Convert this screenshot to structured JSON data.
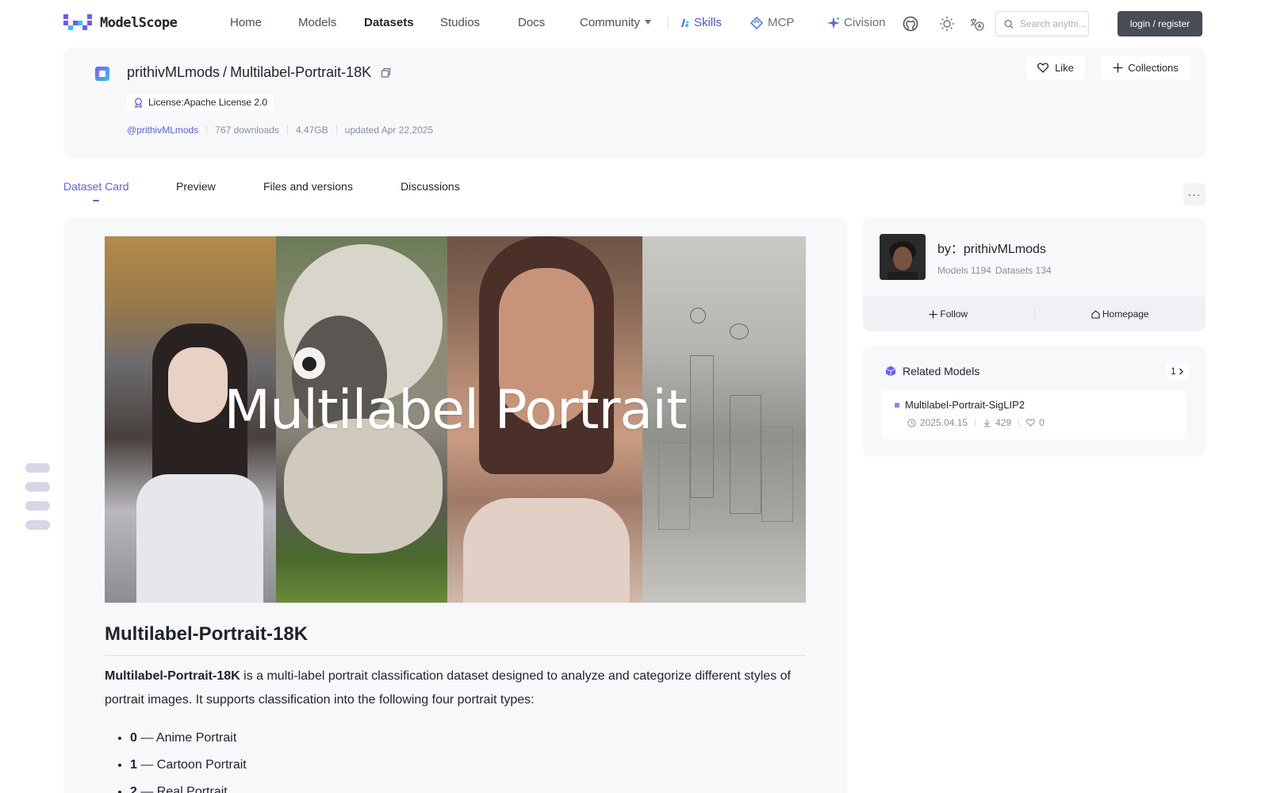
{
  "nav": {
    "logo_text": "ModelScope",
    "items": [
      {
        "label": "Home",
        "active": false
      },
      {
        "label": "Models",
        "active": false
      },
      {
        "label": "Datasets",
        "active": true
      },
      {
        "label": "Studios",
        "active": false
      },
      {
        "label": "Docs",
        "active": false
      },
      {
        "label": "Community",
        "active": false
      }
    ],
    "skills_label": "Skills",
    "mcp_label": "MCP",
    "civision_label": "Civision",
    "search_placeholder": "Search anythi...",
    "login_label": "login / register",
    "icons": [
      "github-icon",
      "theme-sun-icon",
      "language-icon",
      "search-icon"
    ]
  },
  "dataset": {
    "owner": "prithivMLmods",
    "slash": "/",
    "name": "Multilabel-Portrait-18K",
    "license": "License:Apache License 2.0",
    "author_handle": "@prithivMLmods",
    "downloads": "767 downloads",
    "size": "4.47GB",
    "updated": "updated Apr 22,2025",
    "like_label": "Like",
    "collections_label": "Collections"
  },
  "tabs": [
    {
      "label": "Dataset Card",
      "active": true
    },
    {
      "label": "Preview",
      "active": false
    },
    {
      "label": "Files and versions",
      "active": false
    },
    {
      "label": "Discussions",
      "active": false
    }
  ],
  "more_label": "···",
  "card": {
    "banner_title": "Multilabel Portrait",
    "heading": "Multilabel-Portrait-18K",
    "intro_bold": "Multilabel-Portrait-18K",
    "intro_rest": " is a multi-label portrait classification dataset designed to analyze and categorize different styles of portrait images. It supports classification into the following four portrait types:",
    "labels": [
      {
        "id": "0",
        "text": " — Anime Portrait"
      },
      {
        "id": "1",
        "text": " — Cartoon Portrait"
      },
      {
        "id": "2",
        "text": " — Real Portrait"
      }
    ]
  },
  "author": {
    "by_line": "by：prithivMLmods",
    "models": "Models 1194",
    "datasets": "Datasets 134",
    "follow_label": "Follow",
    "homepage_label": "Homepage"
  },
  "related": {
    "title": "Related Models",
    "count": "1",
    "models": [
      {
        "name": "Multilabel-Portrait-SigLIP2",
        "date": "2025.04.15",
        "downloads": "429",
        "likes": "0"
      }
    ]
  },
  "colors": {
    "accent": "#5a5ff0",
    "login_bg": "#474c56",
    "card_bg": "#f7f8fa"
  }
}
